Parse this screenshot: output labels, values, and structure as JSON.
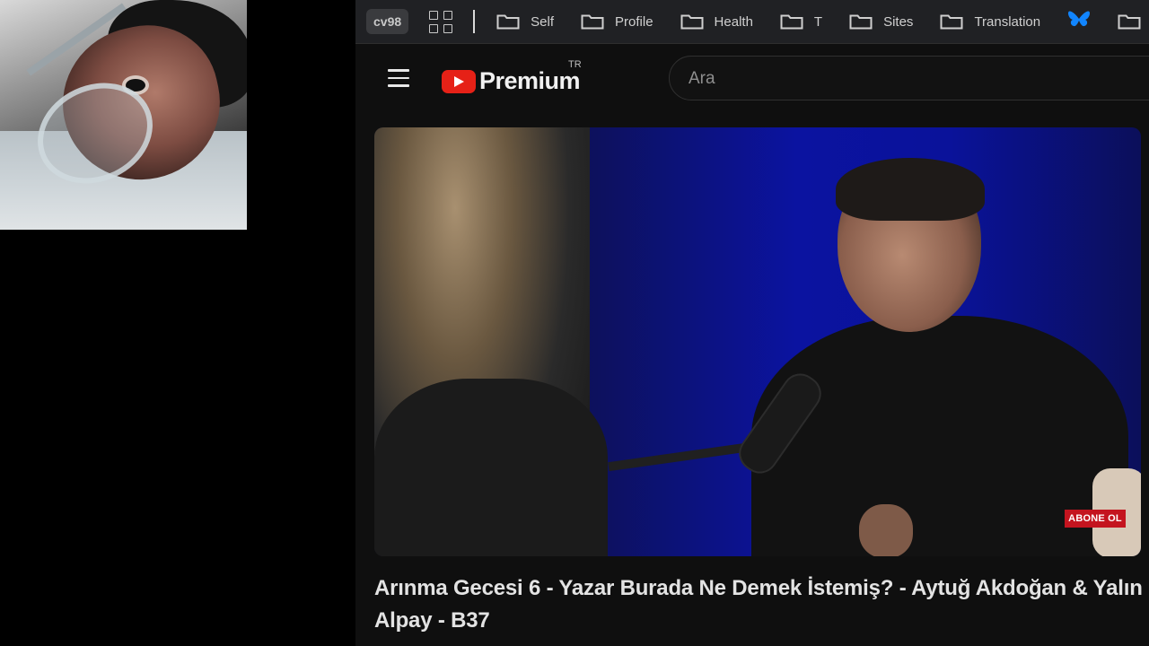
{
  "bookmarks_bar": {
    "profile_chip": "cv98",
    "items": [
      {
        "label": "Self"
      },
      {
        "label": "Profile"
      },
      {
        "label": "Health"
      },
      {
        "label": "T"
      },
      {
        "label": "Sites"
      },
      {
        "label": "Translation"
      }
    ]
  },
  "youtube": {
    "logo_text": "Premium",
    "logo_region": "TR",
    "search_placeholder": "Ara"
  },
  "video": {
    "subscribe_badge": "ABONE OL",
    "title": "Arınma Gecesi 6 - Yazar Burada Ne Demek İstemiş? - Aytuğ Akdoğan & Yalın Alpay - B37"
  },
  "colors": {
    "youtube_red": "#e62117",
    "bookmarks_bg": "#202124",
    "page_bg": "#0f0f0f",
    "bluesky_blue": "#1185fe"
  }
}
